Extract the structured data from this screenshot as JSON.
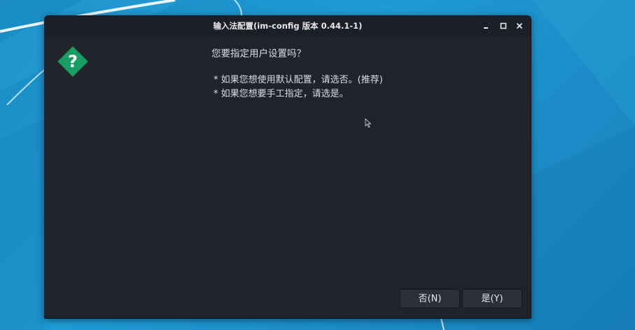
{
  "window": {
    "title": "输入法配置(im-config 版本 0.44.1-1)",
    "controls": {
      "minimize_icon": "minimize-icon",
      "maximize_icon": "maximize-icon",
      "close_icon": "close-icon"
    }
  },
  "dialog": {
    "icon": "question-icon",
    "question": "您要指定用户设置吗？",
    "lines": [
      "* 如果您想使用默认配置，请选否。(推荐)",
      "* 如果您想要手工指定，请选是。"
    ],
    "buttons": {
      "no_label": "否(N)",
      "yes_label": "是(Y)"
    }
  },
  "colors": {
    "desktop_accent": "#1f9ad3",
    "window_bg": "#21232b",
    "icon_green": "#14905a"
  }
}
